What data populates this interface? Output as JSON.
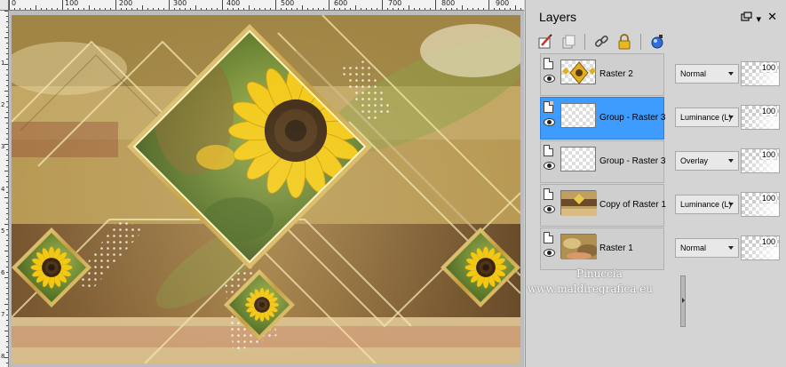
{
  "rulers": {
    "top_labels": [
      "0",
      "100",
      "200",
      "300",
      "400",
      "500",
      "600",
      "700",
      "800",
      "900"
    ],
    "left_labels": [
      "1",
      "2",
      "3",
      "4",
      "5",
      "6",
      "7",
      "8"
    ]
  },
  "layers_panel": {
    "title": "Layers",
    "menu_glyph": "▾",
    "close_glyph": "✕",
    "layers": [
      {
        "name": "Raster 2",
        "blend_mode": "Normal",
        "opacity": "100",
        "selected": false
      },
      {
        "name": "Group - Raster 3",
        "blend_mode": "Luminance (L)",
        "opacity": "100",
        "selected": true
      },
      {
        "name": "Group - Raster 3",
        "blend_mode": "Overlay",
        "opacity": "100",
        "selected": false
      },
      {
        "name": "Copy of Raster 1",
        "blend_mode": "Luminance (L)",
        "opacity": "100",
        "selected": false
      },
      {
        "name": "Raster 1",
        "blend_mode": "Normal",
        "opacity": "100",
        "selected": false
      }
    ]
  },
  "watermark": {
    "name": "Pinuccia",
    "url": "www.maldiregrafica.eu"
  },
  "colors": {
    "selection": "#3f9cff",
    "panel_bg": "#d4d4d4"
  }
}
